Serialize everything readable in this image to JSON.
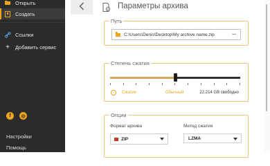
{
  "sidebar": {
    "open_label": "Открыть",
    "create_label": "Создать",
    "links_label": "Ссылки",
    "add_service_label": "Добавить сервис",
    "social": [
      "f",
      "◎"
    ],
    "settings_label": "Настройки",
    "help_label": "Помощь"
  },
  "header": {
    "title": "Параметры архива"
  },
  "path": {
    "legend": "Путь",
    "value": "C:\\Users\\Denis\\Desktop\\My archive name.zip",
    "browse_label": "..."
  },
  "compression": {
    "legend": "Степень сжатия",
    "level_fraction": 0.5,
    "left_label": "Сжатие",
    "current_label": "Обычный",
    "free_space": "22.214 GB свободно"
  },
  "options": {
    "legend": "Опции",
    "format_label": "Формат архива",
    "format_value": "ZIP",
    "method_label": "Метод сжатия",
    "method_value": "LZMA"
  },
  "colors": {
    "accent": "#f0a41e",
    "sidebar_bg": "#2b2b2b"
  }
}
